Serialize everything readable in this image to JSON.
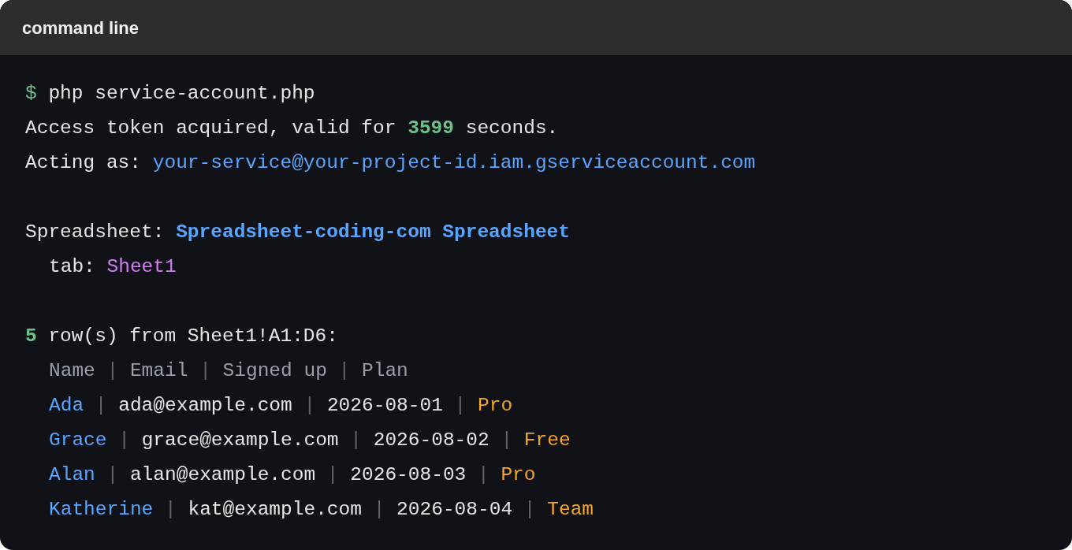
{
  "title": "command line",
  "blocks": [
    [
      {
        "indent": false,
        "segments": [
          {
            "kind": "prompt",
            "text": "$"
          },
          {
            "kind": "text",
            "text": " php service-account.php"
          }
        ]
      },
      {
        "indent": false,
        "segments": [
          {
            "kind": "text",
            "text": "Access token acquired, valid for "
          },
          {
            "kind": "number",
            "text": "3599"
          },
          {
            "kind": "text",
            "text": " seconds."
          }
        ]
      },
      {
        "indent": false,
        "segments": [
          {
            "kind": "text",
            "text": "Acting as: "
          },
          {
            "kind": "link",
            "text": "your-service@your-project-id.iam.gserviceaccount.com"
          }
        ]
      }
    ],
    [
      {
        "indent": false,
        "segments": [
          {
            "kind": "text",
            "text": "Spreadsheet: "
          },
          {
            "kind": "title",
            "text": "Spreadsheet-coding-com Spreadsheet"
          }
        ]
      },
      {
        "indent": true,
        "segments": [
          {
            "kind": "text",
            "text": "tab: "
          },
          {
            "kind": "tab",
            "text": "Sheet1"
          }
        ]
      }
    ],
    [
      {
        "indent": false,
        "segments": [
          {
            "kind": "number",
            "text": "5"
          },
          {
            "kind": "text",
            "text": " row(s) from Sheet1!A1:D6:"
          }
        ]
      },
      {
        "indent": true,
        "segments": [
          {
            "kind": "muted",
            "text": "Name"
          },
          {
            "kind": "sep",
            "text": " | "
          },
          {
            "kind": "muted",
            "text": "Email"
          },
          {
            "kind": "sep",
            "text": " | "
          },
          {
            "kind": "muted",
            "text": "Signed up"
          },
          {
            "kind": "sep",
            "text": " | "
          },
          {
            "kind": "muted",
            "text": "Plan"
          }
        ]
      },
      {
        "indent": true,
        "segments": [
          {
            "kind": "name",
            "text": "Ada"
          },
          {
            "kind": "sep",
            "text": " | "
          },
          {
            "kind": "text",
            "text": "ada@example.com"
          },
          {
            "kind": "sep",
            "text": " | "
          },
          {
            "kind": "text",
            "text": "2026-08-01"
          },
          {
            "kind": "sep",
            "text": " | "
          },
          {
            "kind": "plan",
            "text": "Pro"
          }
        ]
      },
      {
        "indent": true,
        "segments": [
          {
            "kind": "name",
            "text": "Grace"
          },
          {
            "kind": "sep",
            "text": " | "
          },
          {
            "kind": "text",
            "text": "grace@example.com"
          },
          {
            "kind": "sep",
            "text": " | "
          },
          {
            "kind": "text",
            "text": "2026-08-02"
          },
          {
            "kind": "sep",
            "text": " | "
          },
          {
            "kind": "plan",
            "text": "Free"
          }
        ]
      },
      {
        "indent": true,
        "segments": [
          {
            "kind": "name",
            "text": "Alan"
          },
          {
            "kind": "sep",
            "text": " | "
          },
          {
            "kind": "text",
            "text": "alan@example.com"
          },
          {
            "kind": "sep",
            "text": " | "
          },
          {
            "kind": "text",
            "text": "2026-08-03"
          },
          {
            "kind": "sep",
            "text": " | "
          },
          {
            "kind": "plan",
            "text": "Pro"
          }
        ]
      },
      {
        "indent": true,
        "segments": [
          {
            "kind": "name",
            "text": "Katherine"
          },
          {
            "kind": "sep",
            "text": " | "
          },
          {
            "kind": "text",
            "text": "kat@example.com"
          },
          {
            "kind": "sep",
            "text": " | "
          },
          {
            "kind": "text",
            "text": "2026-08-04"
          },
          {
            "kind": "sep",
            "text": " | "
          },
          {
            "kind": "plan",
            "text": "Team"
          }
        ]
      }
    ]
  ]
}
